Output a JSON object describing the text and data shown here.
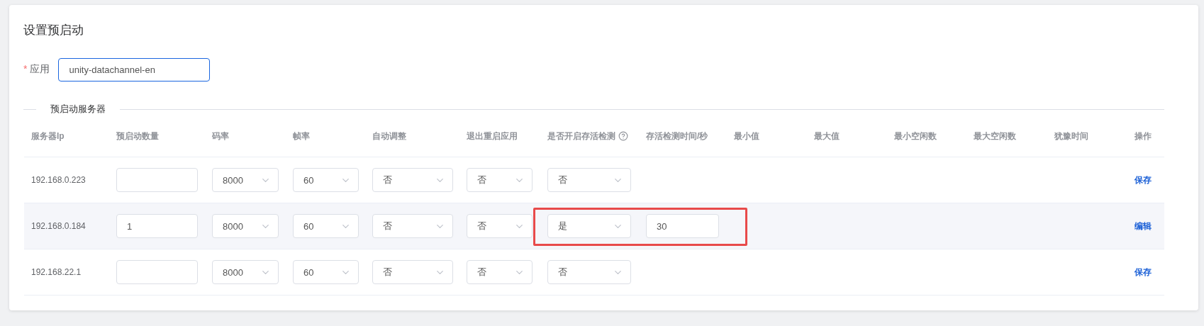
{
  "title": "设置预启动",
  "app_field": {
    "label": "应用",
    "required_mark": "*",
    "value": "unity-datachannel-en"
  },
  "section_title": "预启动服务器",
  "table": {
    "columns": [
      {
        "label": "服务器Ip",
        "help": false
      },
      {
        "label": "预启动数量",
        "help": false
      },
      {
        "label": "码率",
        "help": false
      },
      {
        "label": "帧率",
        "help": false
      },
      {
        "label": "自动调整",
        "help": false
      },
      {
        "label": "退出重启应用",
        "help": false
      },
      {
        "label": "是否开启存活检测",
        "help": true
      },
      {
        "label": "存活检测时间/秒",
        "help": false
      },
      {
        "label": "最小值",
        "help": false
      },
      {
        "label": "最大值",
        "help": false
      },
      {
        "label": "最小空闲数",
        "help": false
      },
      {
        "label": "最大空闲数",
        "help": false
      },
      {
        "label": "犹豫时间",
        "help": false
      },
      {
        "label": "操作",
        "help": false
      }
    ],
    "rows": [
      {
        "ip": "192.168.0.223",
        "hovered": false,
        "highlighted": false,
        "bitrate": "8000",
        "fps": "60",
        "auto_adjust": "否",
        "restart_on_exit": "否",
        "keepalive": "否",
        "action": "保存"
      },
      {
        "ip": "192.168.0.184",
        "hovered": true,
        "highlighted": true,
        "count": "1",
        "bitrate": "8000",
        "fps": "60",
        "auto_adjust": "否",
        "restart_on_exit": "否",
        "keepalive": "是",
        "keepalive_time": "30",
        "action": "编辑"
      },
      {
        "ip": "192.168.22.1",
        "hovered": false,
        "highlighted": false,
        "bitrate": "8000",
        "fps": "60",
        "auto_adjust": "否",
        "restart_on_exit": "否",
        "keepalive": "否",
        "action": "保存"
      }
    ]
  }
}
